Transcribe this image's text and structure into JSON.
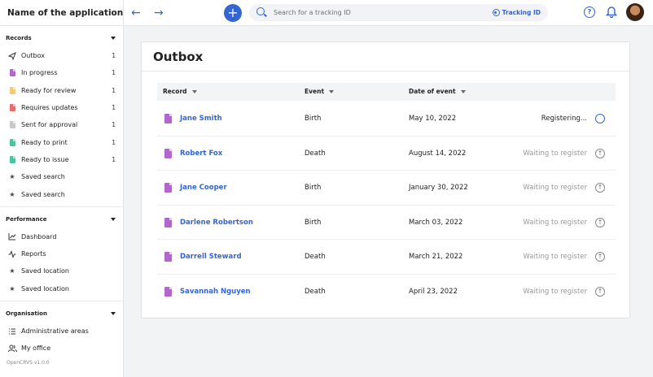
{
  "app": {
    "name": "Name of the application",
    "version": "OpenCRVS  v1.0.0"
  },
  "topbar": {
    "back_icon": "←",
    "forward_icon": "→",
    "new_icon": "+",
    "search_placeholder": "Search for a tracking ID",
    "search_type": "Tracking ID",
    "help_icon": "?"
  },
  "sidebar": {
    "groups": [
      {
        "title": "Records",
        "items": [
          {
            "label": "Outbox",
            "count": "1",
            "icon": "send-icon"
          },
          {
            "label": "In progress",
            "count": "1",
            "icon": "doc-purple-icon",
            "color": "#b167cc"
          },
          {
            "label": "Ready for review",
            "count": "1",
            "icon": "doc-orange-icon",
            "color": "#f5c87a"
          },
          {
            "label": "Requires updates",
            "count": "1",
            "icon": "doc-red-icon",
            "color": "#e86e6e"
          },
          {
            "label": "Sent for approval",
            "count": "1",
            "icon": "doc-grey-icon",
            "color": "#c9c9c9"
          },
          {
            "label": "Ready to print",
            "count": "1",
            "icon": "doc-green-icon",
            "color": "#4fc3a1"
          },
          {
            "label": "Ready to issue",
            "count": "1",
            "icon": "doc-teal-icon",
            "color": "#4fc3a1"
          },
          {
            "label": "Saved search",
            "count": "",
            "icon": "star-icon"
          },
          {
            "label": "Saved search",
            "count": "",
            "icon": "star-icon"
          }
        ]
      },
      {
        "title": "Performance",
        "items": [
          {
            "label": "Dashboard",
            "icon": "chart-icon"
          },
          {
            "label": "Reports",
            "icon": "activity-icon"
          },
          {
            "label": "Saved location",
            "icon": "star-icon"
          },
          {
            "label": "Saved location",
            "icon": "star-icon"
          }
        ]
      },
      {
        "title": "Organisation",
        "items": [
          {
            "label": "Administrative areas",
            "icon": "list-icon"
          },
          {
            "label": "My office",
            "icon": "users-icon"
          }
        ]
      }
    ]
  },
  "outbox": {
    "title": "Outbox",
    "columns": {
      "record": "Record",
      "event": "Event",
      "date": "Date of event"
    },
    "rows": [
      {
        "name": "Jane Smith",
        "event": "Birth",
        "date": "May 10, 2022",
        "status": "Registering...",
        "active": true
      },
      {
        "name": "Robert Fox",
        "event": "Death",
        "date": "August 14, 2022",
        "status": "Waiting to register",
        "active": false
      },
      {
        "name": "Jane Cooper",
        "event": "Birth",
        "date": "January 30, 2022",
        "status": "Waiting to register",
        "active": false
      },
      {
        "name": "Darlene Robertson",
        "event": "Birth",
        "date": "March 03, 2022",
        "status": "Waiting to register",
        "active": false
      },
      {
        "name": "Darrell Steward",
        "event": "Death",
        "date": "March 21, 2022",
        "status": "Waiting to register",
        "active": false
      },
      {
        "name": "Savannah Nguyen",
        "event": "Death",
        "date": "April 23, 2022",
        "status": "Waiting to register",
        "active": false
      }
    ]
  },
  "colors": {
    "accent": "#3565d3",
    "record_doc": "#b167cc",
    "star": "#f2b20e"
  }
}
